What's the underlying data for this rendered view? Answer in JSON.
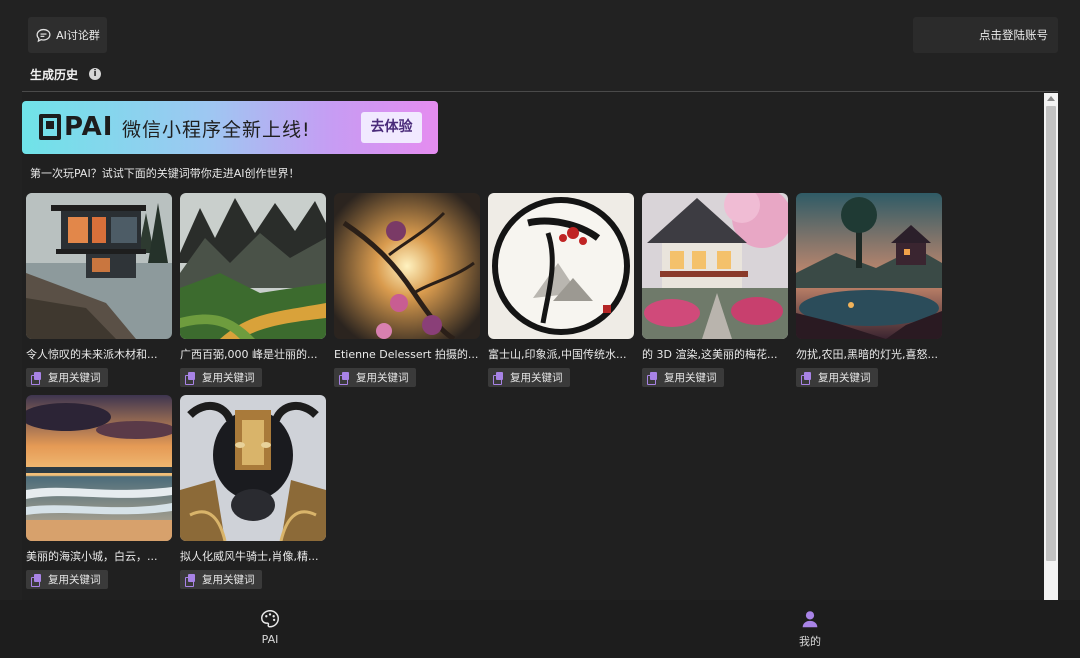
{
  "header": {
    "group_label": "AI讨论群",
    "group_icon": "chat-bubble-icon",
    "login_label": "点击登陆账号"
  },
  "history": {
    "title": "生成历史",
    "info_icon": "info-icon"
  },
  "banner": {
    "logo": "PAI",
    "text": "微信小程序全新上线!",
    "cta": "去体验"
  },
  "intro": "第一次玩PAI？试试下面的关键词带你走进AI创作世界！",
  "cards": [
    {
      "caption": "令人惊叹的未来派木材和...",
      "reuse_label": "复用关键词"
    },
    {
      "caption": "广西百弼,000 峰是壮丽的...",
      "reuse_label": "复用关键词"
    },
    {
      "caption": "Etienne Delessert 拍摄的...",
      "reuse_label": "复用关键词"
    },
    {
      "caption": "富士山,印象派,中国传统水...",
      "reuse_label": "复用关键词"
    },
    {
      "caption": "的 3D 渲染,这美丽的梅花...",
      "reuse_label": "复用关键词"
    },
    {
      "caption": "勿扰,农田,黑暗的灯光,喜怒...",
      "reuse_label": "复用关键词"
    },
    {
      "caption": "美丽的海滨小城，白云，...",
      "reuse_label": "复用关键词"
    },
    {
      "caption": "拟人化威风牛骑士,肖像,精...",
      "reuse_label": "复用关键词"
    }
  ],
  "bottom_nav": {
    "items": [
      {
        "label": "PAI",
        "icon": "palette-icon"
      },
      {
        "label": "我的",
        "icon": "user-icon"
      }
    ]
  },
  "colors": {
    "background": "#222222",
    "accent": "#a883e6",
    "banner_gradient_start": "#6fe3e8",
    "banner_gradient_end": "#e58cf0"
  }
}
